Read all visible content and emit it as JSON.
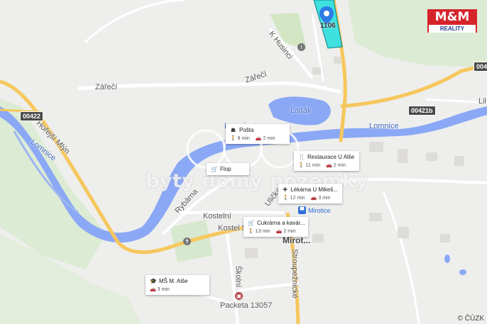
{
  "labels": {
    "street_k_husinci": "K Husinci",
    "street_zareci_1": "Zářečí",
    "street_zareci_2": "Zářečí",
    "lake_lajtak": "Lajták",
    "river_lomnice_1": "Lomnice",
    "river_lomnice_2": "Lomnice",
    "river_lomnice_3": "Lomnice",
    "street_horejsi_mlyn": "Hořejší Mlýn",
    "street_rybarna": "Rybárna",
    "street_ulicka": "Ulička",
    "street_kostelni": "Kostelní",
    "street_kostel_sv": "Kostel Sv.",
    "street_skolni": "Školní",
    "street_stroupeznicke": "Stroupežnické",
    "town_mirotice": "Mirot...",
    "street_packeta": "Packeta 13057",
    "street_lil": "Lil"
  },
  "road_numbers": {
    "r00422": "00422",
    "r00421b": "00421b",
    "r004": "004"
  },
  "parcel_number": "1106",
  "bus_stop": "Mirotice",
  "watermark": "byty domy pozemky",
  "brand": {
    "top": "M&M",
    "bottom": "REALITY"
  },
  "copyright": "© ČÚZK",
  "pois": [
    {
      "name": "Pošta",
      "walk": "8 min",
      "car": "2 min",
      "icon": "person-icon"
    },
    {
      "name": "Restaurace U Alše",
      "walk": "11 min",
      "car": "2 min",
      "icon": "fork-knife-icon"
    },
    {
      "name": "Flop",
      "walk": "",
      "car": "",
      "icon": "cart-icon"
    },
    {
      "name": "Lékárna U Mikeš...",
      "walk": "12 min",
      "car": "3 min",
      "icon": "pharmacy-icon"
    },
    {
      "name": "Cukrárna a kavár...",
      "walk": "13 min",
      "car": "2 min",
      "icon": "cart-icon"
    },
    {
      "name": "MŠ M. Alše",
      "walk": "",
      "car": "3 min",
      "icon": "school-icon"
    }
  ],
  "colors": {
    "water": "#a3bdf0",
    "river": "#8aa8f5",
    "road_major": "#f6c75c",
    "road_minor": "#ffffff",
    "green": "#dcebd4",
    "parcel": "#3ee0e0",
    "pin": "#2c7be5"
  }
}
